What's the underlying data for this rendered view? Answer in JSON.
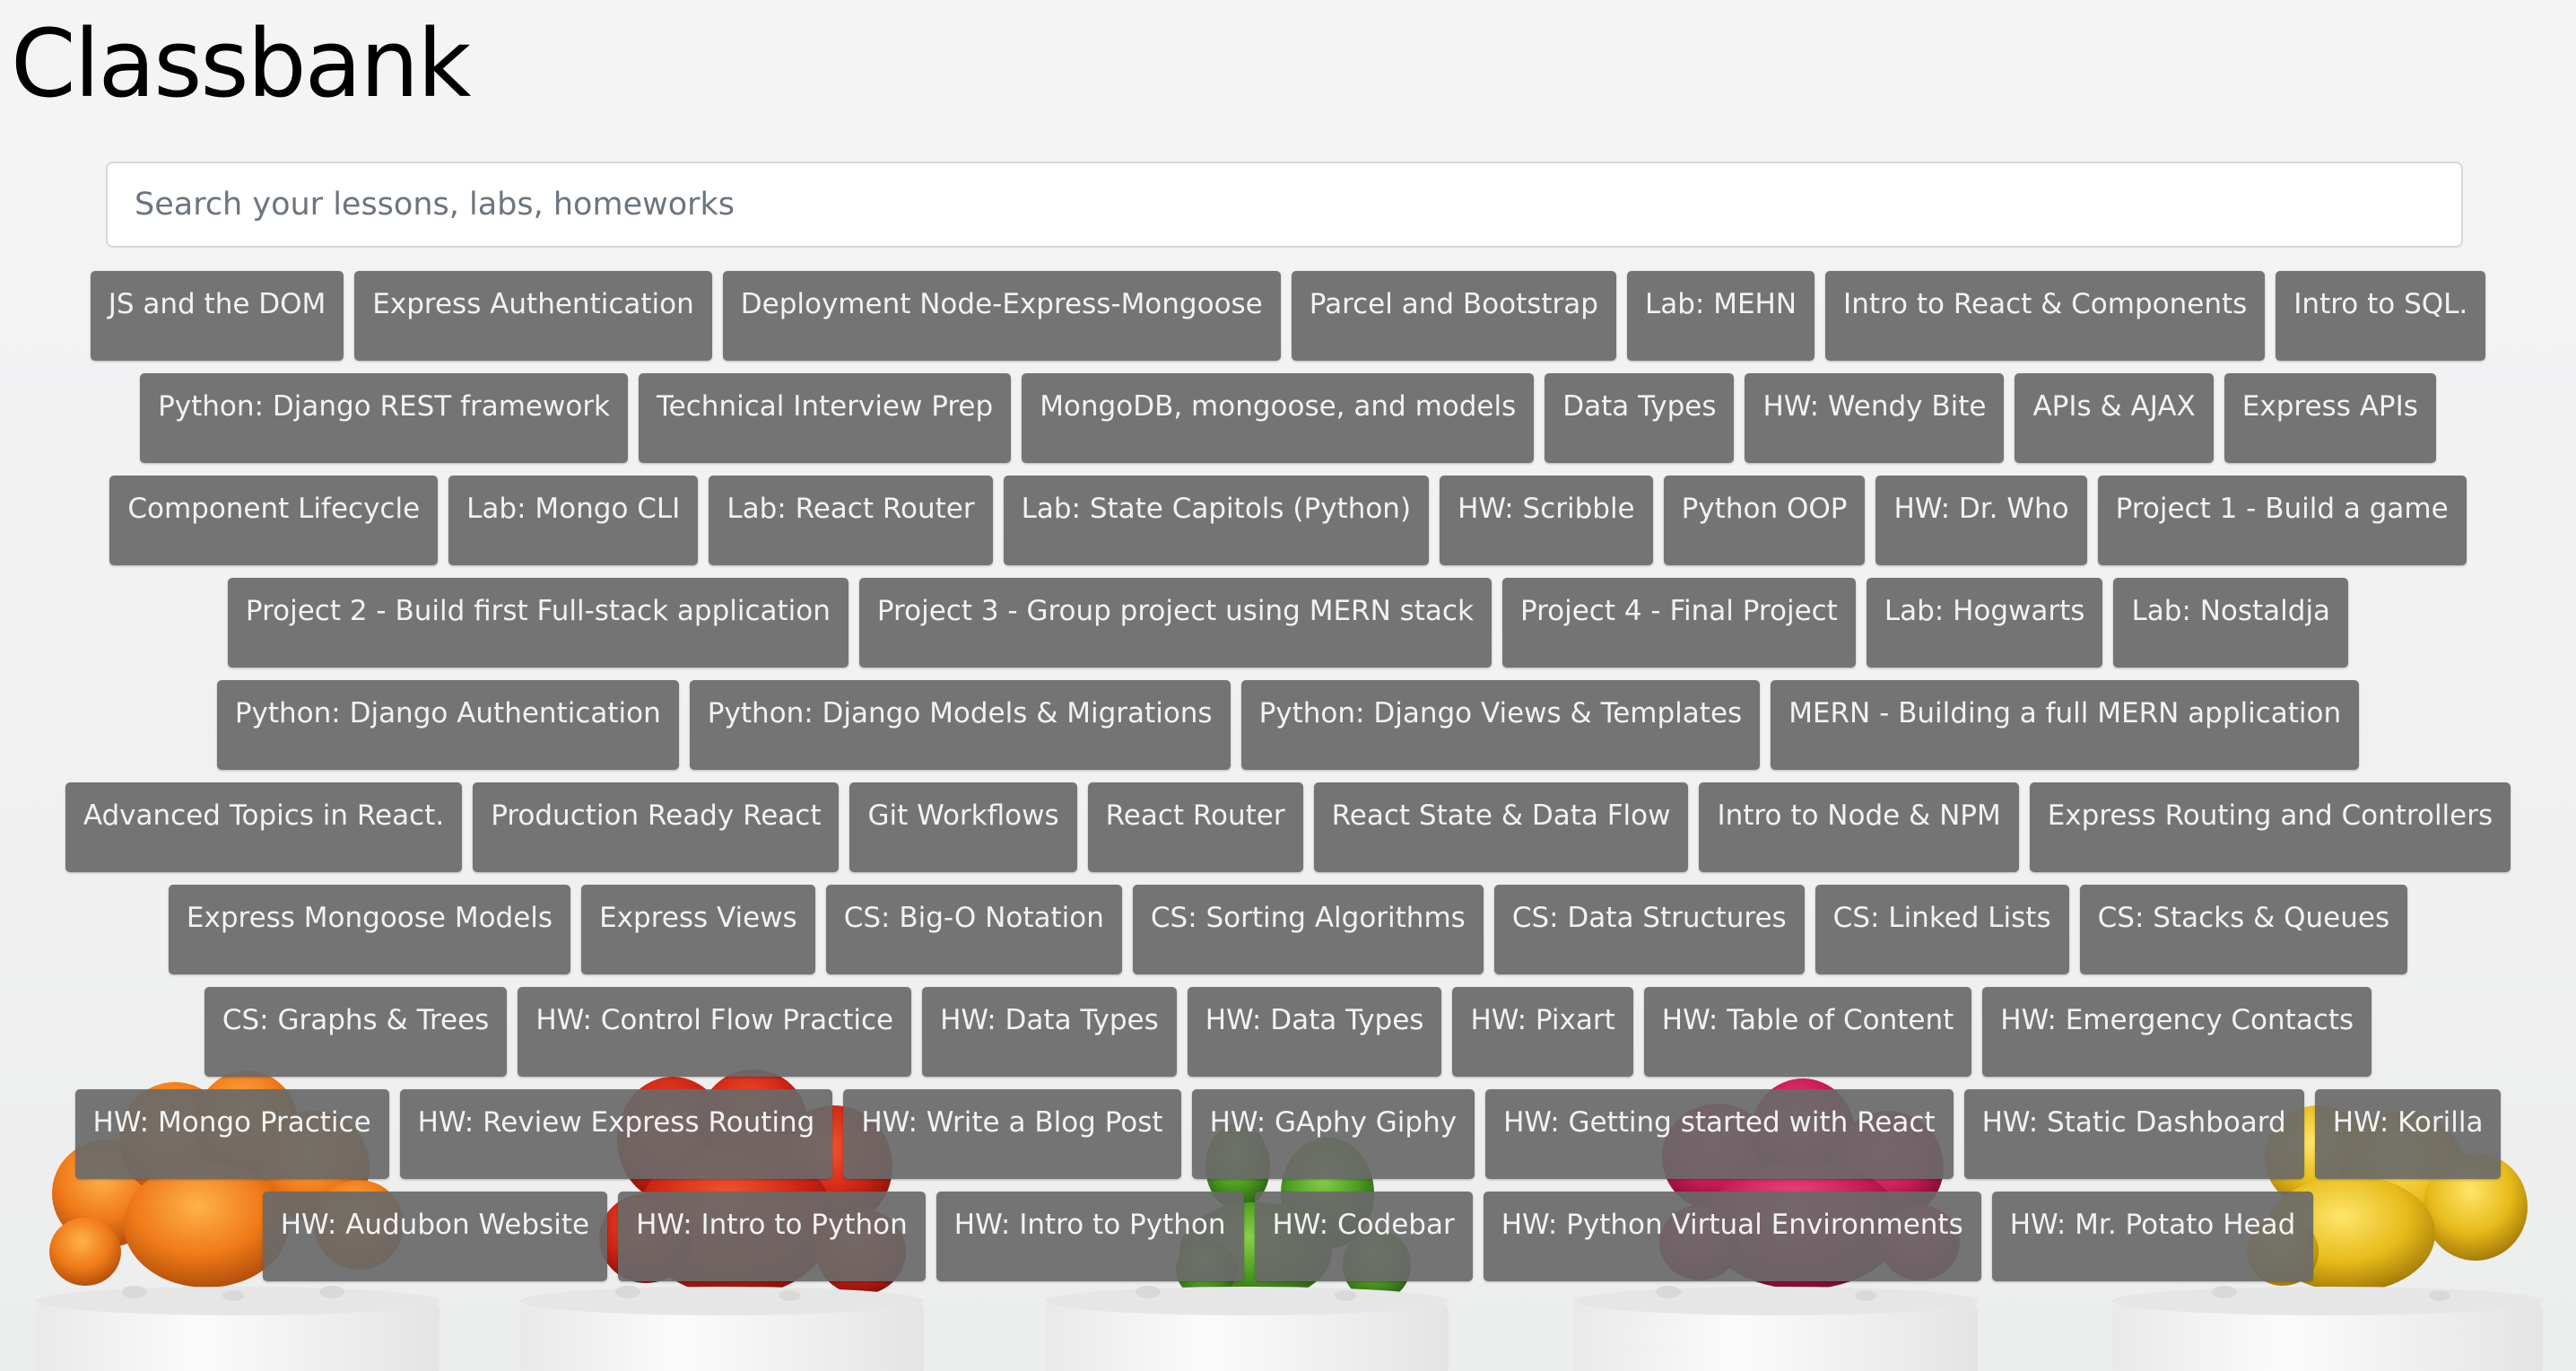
{
  "app": {
    "title": "Classbank"
  },
  "search": {
    "placeholder": "Search your lessons, labs, homeworks",
    "value": ""
  },
  "tags": [
    "JS and the DOM",
    "Express Authentication",
    "Deployment Node-Express-Mongoose",
    "Parcel and Bootstrap",
    "Lab: MEHN",
    "Intro to React & Components",
    "Intro to SQL.",
    "Python: Django REST framework",
    "Technical Interview Prep",
    "MongoDB, mongoose, and models",
    "Data Types",
    "HW: Wendy Bite",
    "APIs & AJAX",
    "Express APIs",
    "Component Lifecycle",
    "Lab: Mongo CLI",
    "Lab: React Router",
    "Lab: State Capitols (Python)",
    "HW: Scribble",
    "Python OOP",
    "HW: Dr. Who",
    "Project 1 - Build a game",
    "Project 2 - Build first Full-stack application",
    "Project 3 - Group project using MERN stack",
    "Project 4 - Final Project",
    "Lab: Hogwarts",
    "Lab: Nostaldja",
    "Python: Django Authentication",
    "Python: Django Models & Migrations",
    "Python: Django Views & Templates",
    "MERN - Building a full MERN application",
    "Advanced Topics in React.",
    "Production Ready React",
    "Git Workflows",
    "React Router",
    "React State & Data Flow",
    "Intro to Node & NPM",
    "Express Routing and Controllers",
    "Express Mongoose Models",
    "Express Views",
    "CS: Big-O Notation",
    "CS: Sorting Algorithms",
    "CS: Data Structures",
    "CS: Linked Lists",
    "CS: Stacks & Queues",
    "CS: Graphs & Trees",
    "HW: Control Flow Practice",
    "HW: Data Types",
    "HW: Data Types",
    "HW: Pixart",
    "HW: Table of Content",
    "HW: Emergency Contacts",
    "HW: Mongo Practice",
    "HW: Review Express Routing",
    "HW: Write a Blog Post",
    "HW: GAphy Giphy",
    "HW: Getting started with React",
    "HW: Static Dashboard",
    "HW: Korilla",
    "HW: Audubon Website",
    "HW: Intro to Python",
    "HW: Intro to Python",
    "HW: Codebar",
    "HW: Python Virtual Environments",
    "HW: Mr. Potato Head"
  ],
  "background": {
    "cactus_colors": [
      "#f07a1a",
      "#d22616",
      "#4c9a22",
      "#c81a55",
      "#e7bb1a"
    ],
    "pot_color": "#f7f7f7"
  }
}
